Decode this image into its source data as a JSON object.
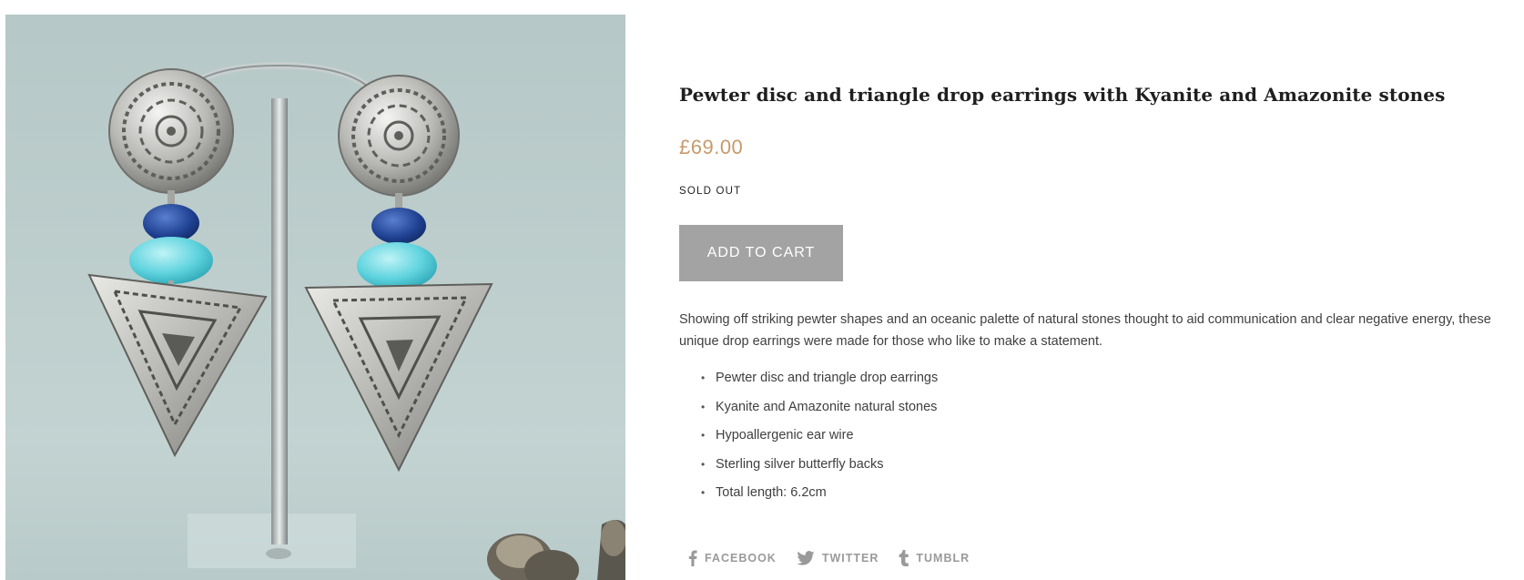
{
  "product": {
    "image_alt": "Pewter disc and triangle drop earrings on a stand",
    "title": "Pewter disc and triangle drop earrings with Kyanite and Amazonite stones",
    "price": "£69.00",
    "availability": "SOLD OUT",
    "add_to_cart_label": "ADD TO CART",
    "description": "Showing off striking pewter shapes and an oceanic palette of natural stones thought to aid communication and clear negative energy, these unique drop earrings were made for those who like to make a statement.",
    "features": [
      "Pewter disc and triangle drop earrings",
      "Kyanite and Amazonite natural stones",
      "Hypoallergenic ear wire",
      "Sterling silver butterfly backs",
      "Total length: 6.2cm"
    ]
  },
  "share": {
    "facebook_label": "FACEBOOK",
    "twitter_label": "TWITTER",
    "tumblr_label": "TUMBLR",
    "facebook_icon": "facebook-icon",
    "twitter_icon": "twitter-icon",
    "tumblr_icon": "tumblr-icon"
  },
  "colors": {
    "price": "#c79a6a",
    "button_bg": "#a3a3a3",
    "share_text": "#9a9a9a"
  }
}
